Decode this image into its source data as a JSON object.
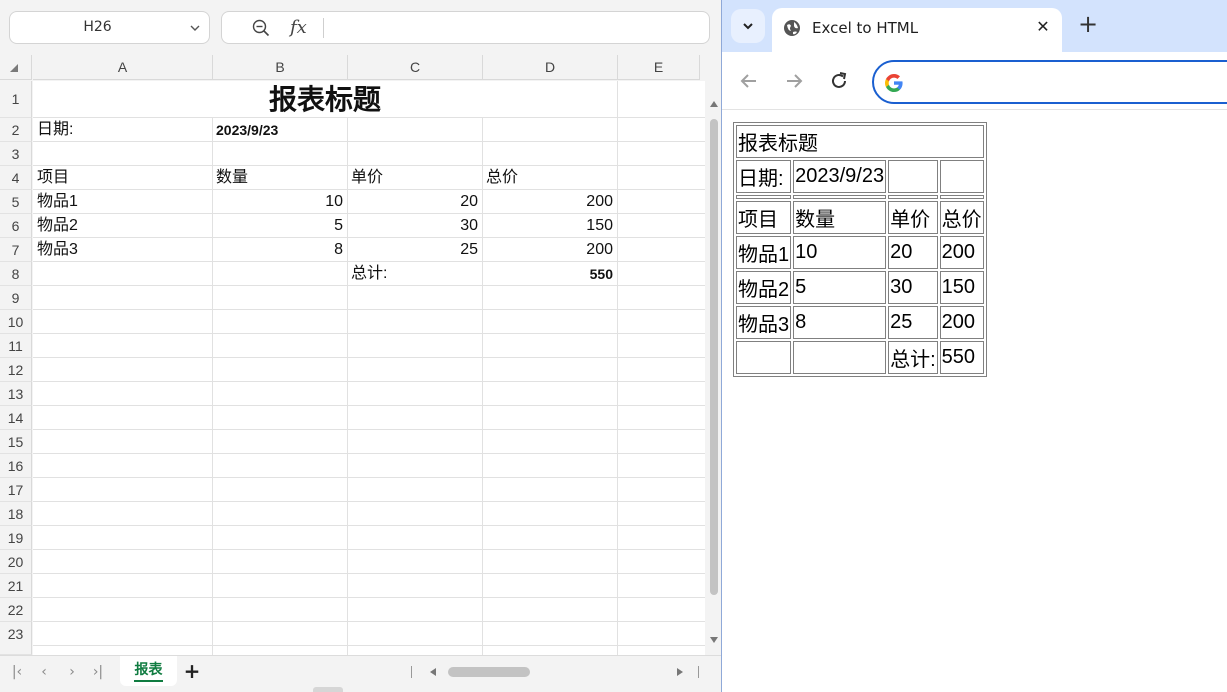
{
  "spreadsheet": {
    "name_box": "H26",
    "fx_label": "fx",
    "columns": [
      "A",
      "B",
      "C",
      "D",
      "E"
    ],
    "rows": [
      "1",
      "2",
      "3",
      "4",
      "5",
      "6",
      "7",
      "8",
      "9",
      "10",
      "11",
      "12",
      "13",
      "14",
      "15",
      "16",
      "17",
      "18",
      "19",
      "20",
      "21",
      "22",
      "23"
    ],
    "title": "报表标题",
    "date_label": "日期:",
    "date_value": "2023/9/23",
    "headers": [
      "项目",
      "数量",
      "单价",
      "总价"
    ],
    "items": [
      {
        "name": "物品1",
        "qty": "10",
        "price": "20",
        "total": "200"
      },
      {
        "name": "物品2",
        "qty": "5",
        "price": "30",
        "total": "150"
      },
      {
        "name": "物品3",
        "qty": "8",
        "price": "25",
        "total": "200"
      }
    ],
    "total_label": "总计:",
    "total_value": "550",
    "sheet_tab": "报表",
    "nav": {
      "first": "|‹",
      "prev": "‹",
      "next": "›",
      "last": "›|",
      "add": "+"
    }
  },
  "browser": {
    "tab_title": "Excel to HTML",
    "tab_close": "✕",
    "new_tab": "+",
    "address_value": "",
    "table": {
      "title": "报表标题",
      "date_label": "日期:",
      "date_value": "2023/9/23",
      "headers": [
        "项目",
        "数量",
        "单价",
        "总价"
      ],
      "rows": [
        [
          "物品1",
          "10",
          "20",
          "200"
        ],
        [
          "物品2",
          "5",
          "30",
          "150"
        ],
        [
          "物品3",
          "8",
          "25",
          "200"
        ]
      ],
      "total_label": "总计:",
      "total_value": "550"
    }
  },
  "colors": {
    "excel_green": "#107c41",
    "chrome_tabstrip": "#d3e3fd",
    "omnibox_border": "#1a5fd0"
  }
}
